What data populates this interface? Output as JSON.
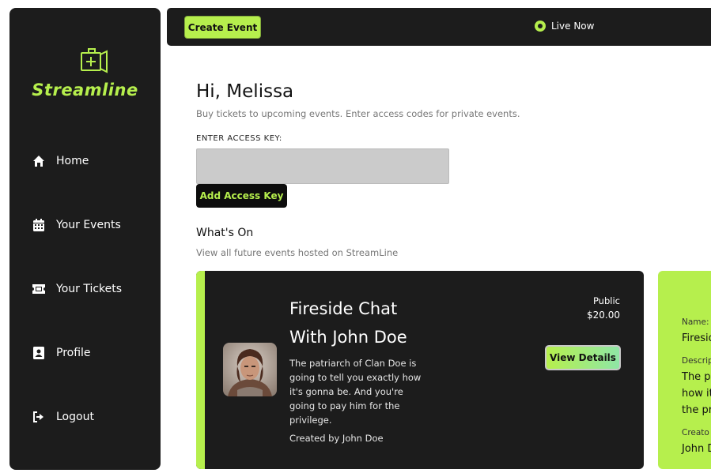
{
  "brand": {
    "name": "Streamline",
    "accent": "#b6ef4d",
    "dark": "#1c1c1c"
  },
  "sidebar": {
    "items": [
      {
        "label": "Home",
        "icon": "home-icon"
      },
      {
        "label": "Your Events",
        "icon": "calendar-icon"
      },
      {
        "label": "Your Tickets",
        "icon": "ticket-icon"
      },
      {
        "label": "Profile",
        "icon": "profile-icon"
      },
      {
        "label": "Logout",
        "icon": "logout-icon"
      }
    ]
  },
  "topbar": {
    "create_label": "Create Event",
    "live_label": "Live Now"
  },
  "main": {
    "greeting": "Hi, Melissa",
    "subtitle": "Buy tickets to upcoming events. Enter access codes for private events.",
    "access_key_label": "ENTER ACCESS KEY:",
    "access_key_value": "",
    "add_key_label": "Add Access Key",
    "section_title": "What's On",
    "section_subtitle": "View all future events hosted on StreamLine"
  },
  "event": {
    "title_line1": "Fireside Chat",
    "title_line2": "With John Doe",
    "description": "The patriarch of Clan Doe is going to tell you exactly how it's gonna be. And you're going to pay him for the privilege.",
    "creator": "Created by John Doe",
    "visibility": "Public",
    "price": "$20.00",
    "view_label": "View Details"
  },
  "detail_panel": {
    "name_label": "Name:",
    "name_value": "Firesid",
    "description_label": "Descrip",
    "description_line1": "The pa",
    "description_line2": "how it",
    "description_line3": "the pri",
    "creator_label": "Creato",
    "creator_value": "John D"
  }
}
